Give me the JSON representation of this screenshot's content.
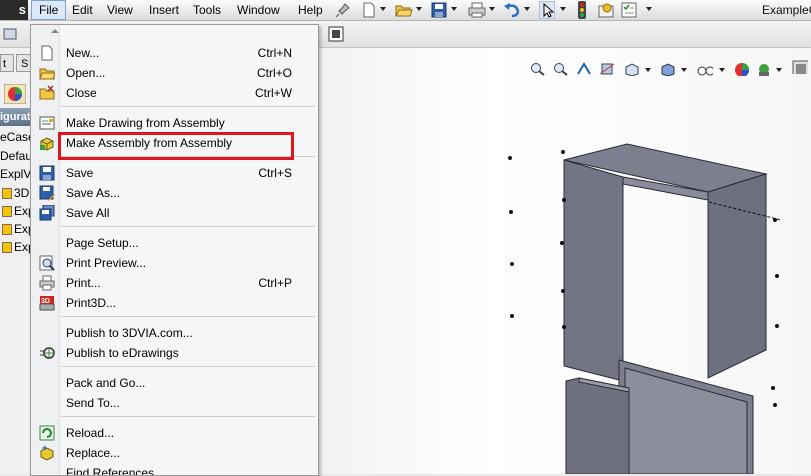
{
  "app": {
    "brand_fragment": "s",
    "window_title": "ExampleC"
  },
  "menubar": {
    "items": [
      "File",
      "Edit",
      "View",
      "Insert",
      "Tools",
      "Window",
      "Help"
    ]
  },
  "left_panel": {
    "tabs": [
      "t",
      "S"
    ],
    "header": "iguratio",
    "tree": [
      "eCase",
      "Default",
      "ExplVie",
      "3D",
      "Exp",
      "Exp",
      "Exp"
    ]
  },
  "file_menu": {
    "items": [
      {
        "label": "New...",
        "shortcut": "Ctrl+N",
        "icon": "new-document-icon"
      },
      {
        "label": "Open...",
        "shortcut": "Ctrl+O",
        "icon": "open-folder-icon"
      },
      {
        "label": "Close",
        "shortcut": "Ctrl+W",
        "icon": "close-folder-icon"
      },
      {
        "label": "Make Drawing from Assembly",
        "shortcut": "",
        "icon": "make-drawing-icon"
      },
      {
        "label": "Make Assembly from Assembly",
        "shortcut": "",
        "icon": "make-assembly-icon"
      },
      {
        "label": "Save",
        "shortcut": "Ctrl+S",
        "icon": "save-icon"
      },
      {
        "label": "Save As...",
        "shortcut": "",
        "icon": "save-as-icon"
      },
      {
        "label": "Save All",
        "shortcut": "",
        "icon": "save-all-icon"
      },
      {
        "label": "Page Setup...",
        "shortcut": "",
        "icon": ""
      },
      {
        "label": "Print Preview...",
        "shortcut": "",
        "icon": "print-preview-icon"
      },
      {
        "label": "Print...",
        "shortcut": "Ctrl+P",
        "icon": "printer-icon"
      },
      {
        "label": "Print3D...",
        "shortcut": "",
        "icon": "print3d-icon"
      },
      {
        "label": "Publish to 3DVIA.com...",
        "shortcut": "",
        "icon": ""
      },
      {
        "label": "Publish to eDrawings",
        "shortcut": "",
        "icon": "edrawings-icon"
      },
      {
        "label": "Pack and Go...",
        "shortcut": "",
        "icon": ""
      },
      {
        "label": "Send To...",
        "shortcut": "",
        "icon": ""
      },
      {
        "label": "Reload...",
        "shortcut": "",
        "icon": "reload-icon"
      },
      {
        "label": "Replace...",
        "shortcut": "",
        "icon": "replace-icon"
      },
      {
        "label": "Find References...",
        "shortcut": "",
        "icon": ""
      }
    ]
  },
  "colors": {
    "highlight_box": "#e0141e",
    "model_face": "#7d7f8f",
    "model_edge": "#2a2a33"
  }
}
